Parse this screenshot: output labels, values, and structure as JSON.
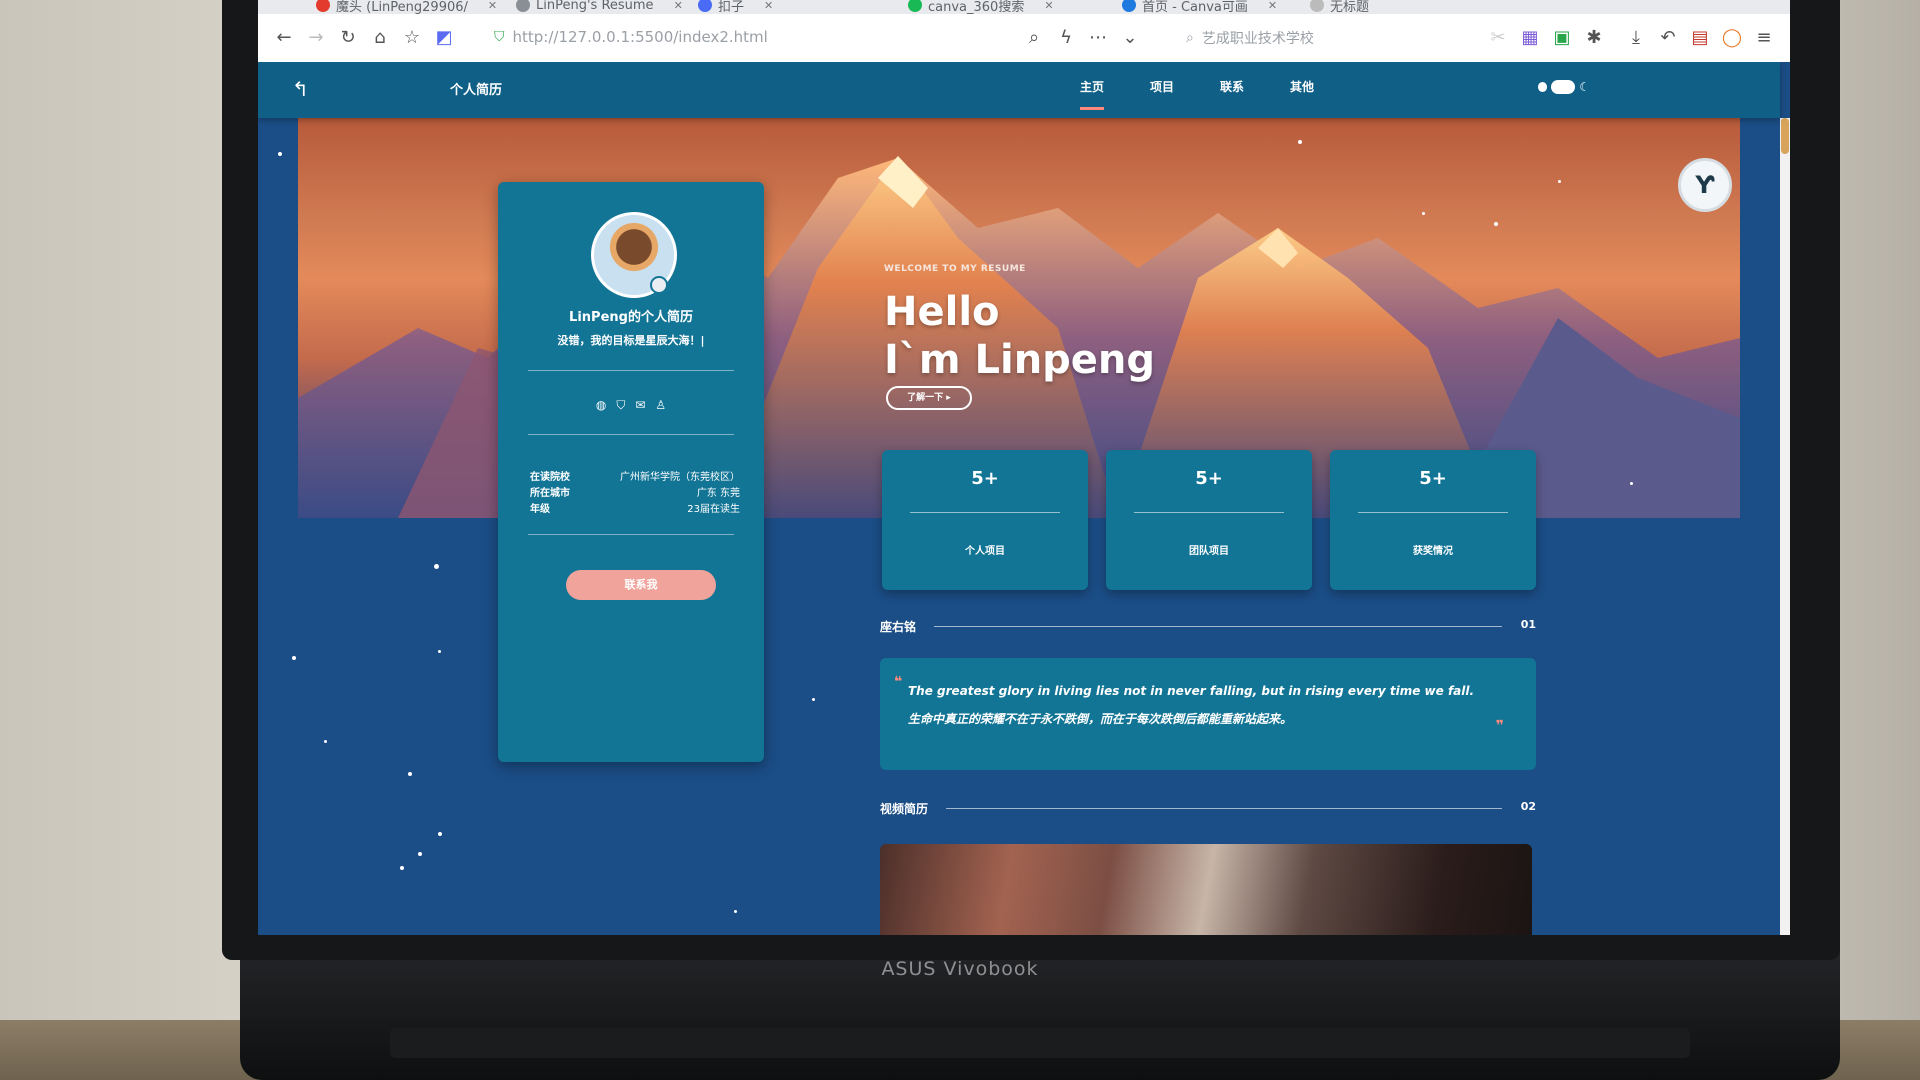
{
  "device": {
    "brand": "ASUS Vivobook"
  },
  "browser": {
    "tabs": [
      {
        "label": "魔头 (LinPeng29906/",
        "color": "#e33b2e"
      },
      {
        "label": "LinPeng's Resume",
        "color": "#8a8f96"
      },
      {
        "label": "扣子",
        "color": "#4a6bf5"
      },
      {
        "label": "canva_360搜索",
        "color": "#19b955"
      },
      {
        "label": "首页 - Canva可画",
        "color": "#1f7ae0"
      },
      {
        "label": "无标题",
        "color": "#bbbbbb"
      }
    ],
    "url": "http://127.0.0.1:5500/index2.html",
    "search_box": "艺成职业技术学校"
  },
  "site": {
    "nav": {
      "back_icon": "arrow-left-icon",
      "title": "个人简历",
      "items": [
        "主页",
        "项目",
        "联系",
        "其他"
      ],
      "active": "主页"
    },
    "profile": {
      "name": "LinPeng的个人简历",
      "motto": "没错，我的目标是星辰大海！|",
      "social_icons": [
        "wechat-icon",
        "shield-icon",
        "mail-icon",
        "qq-icon"
      ],
      "info": [
        {
          "label": "在读院校",
          "value": "广州新华学院（东莞校区）"
        },
        {
          "label": "所在城市",
          "value": "广东 东莞"
        },
        {
          "label": "年级",
          "value": "23届在读生"
        }
      ],
      "button": "联系我"
    },
    "hero": {
      "small": "WELCOME TO MY RESUME",
      "line1": "Hello",
      "line2": "I`m Linpeng",
      "button": "了解一下 ▸"
    },
    "stats": [
      {
        "value": "5+",
        "label": "个人项目"
      },
      {
        "value": "5+",
        "label": "团队项目"
      },
      {
        "value": "5+",
        "label": "获奖情况"
      }
    ],
    "sections": [
      {
        "title": "座右铭",
        "index": "01"
      },
      {
        "title": "视频简历",
        "index": "02"
      }
    ],
    "quote": {
      "mark": "❞",
      "en": "The greatest glory in living lies not in never falling, but in rising every time we fall.",
      "zh": "生命中真正的荣耀不在于永不跌倒，而在于每次跌倒后都能重新站起来。"
    },
    "colors": {
      "accent": "#ff8a7a",
      "card": "#137596",
      "bg": "#1b4d86",
      "nav": "#0f5f87"
    }
  }
}
